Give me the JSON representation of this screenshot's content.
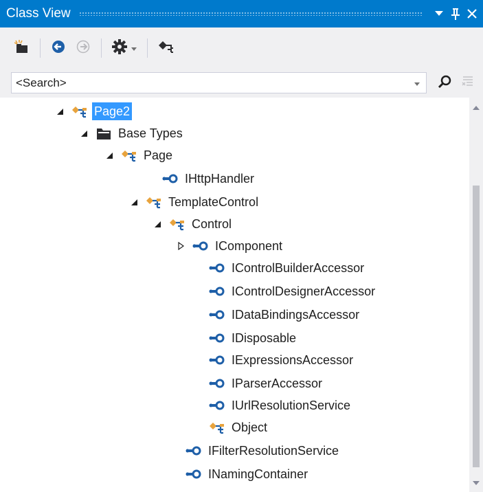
{
  "window": {
    "title": "Class View",
    "menu_icon": "dropdown-triangle-icon",
    "pin_icon": "pin-icon",
    "close_icon": "close-icon"
  },
  "toolbar": {
    "buttons": [
      {
        "name": "new-folder",
        "icon": "new-folder-icon",
        "enabled": true
      },
      {
        "name": "back",
        "icon": "arrow-left-icon",
        "enabled": true
      },
      {
        "name": "forward",
        "icon": "arrow-right-icon",
        "enabled": false
      },
      {
        "name": "settings",
        "icon": "gear-icon",
        "enabled": true
      },
      {
        "name": "view-class-diagram",
        "icon": "class-hierarchy-icon",
        "enabled": true
      }
    ]
  },
  "search": {
    "value": "<Search>",
    "search_icon": "magnifier-icon",
    "clear_icon": "clear-search-icon"
  },
  "tree": {
    "items": [
      {
        "label": "Page2",
        "icon": "class-icon",
        "expander": "expanded",
        "selected": true
      },
      {
        "label": "Base Types",
        "icon": "folder-icon",
        "expander": "expanded",
        "selected": false
      },
      {
        "label": "Page",
        "icon": "class-icon",
        "expander": "expanded",
        "selected": false
      },
      {
        "label": "IHttpHandler",
        "icon": "interface-icon",
        "expander": "none",
        "selected": false
      },
      {
        "label": "TemplateControl",
        "icon": "class-icon",
        "expander": "expanded",
        "selected": false
      },
      {
        "label": "Control",
        "icon": "class-icon",
        "expander": "expanded",
        "selected": false
      },
      {
        "label": "IComponent",
        "icon": "interface-icon",
        "expander": "collapsed",
        "selected": false
      },
      {
        "label": "IControlBuilderAccessor",
        "icon": "interface-icon",
        "expander": "none",
        "selected": false
      },
      {
        "label": "IControlDesignerAccessor",
        "icon": "interface-icon",
        "expander": "none",
        "selected": false
      },
      {
        "label": "IDataBindingsAccessor",
        "icon": "interface-icon",
        "expander": "none",
        "selected": false
      },
      {
        "label": "IDisposable",
        "icon": "interface-icon",
        "expander": "none",
        "selected": false
      },
      {
        "label": "IExpressionsAccessor",
        "icon": "interface-icon",
        "expander": "none",
        "selected": false
      },
      {
        "label": "IParserAccessor",
        "icon": "interface-icon",
        "expander": "none",
        "selected": false
      },
      {
        "label": "IUrlResolutionService",
        "icon": "interface-icon",
        "expander": "none",
        "selected": false
      },
      {
        "label": "Object",
        "icon": "class-icon",
        "expander": "none",
        "selected": false
      },
      {
        "label": "IFilterResolutionService",
        "icon": "interface-icon",
        "expander": "none",
        "selected": false
      },
      {
        "label": "INamingContainer",
        "icon": "interface-icon",
        "expander": "none",
        "selected": false
      }
    ]
  },
  "colors": {
    "accent": "#007acc",
    "selection": "#3399ff",
    "class_icon": "#e8a33d",
    "interface_icon": "#1e5fa8"
  }
}
